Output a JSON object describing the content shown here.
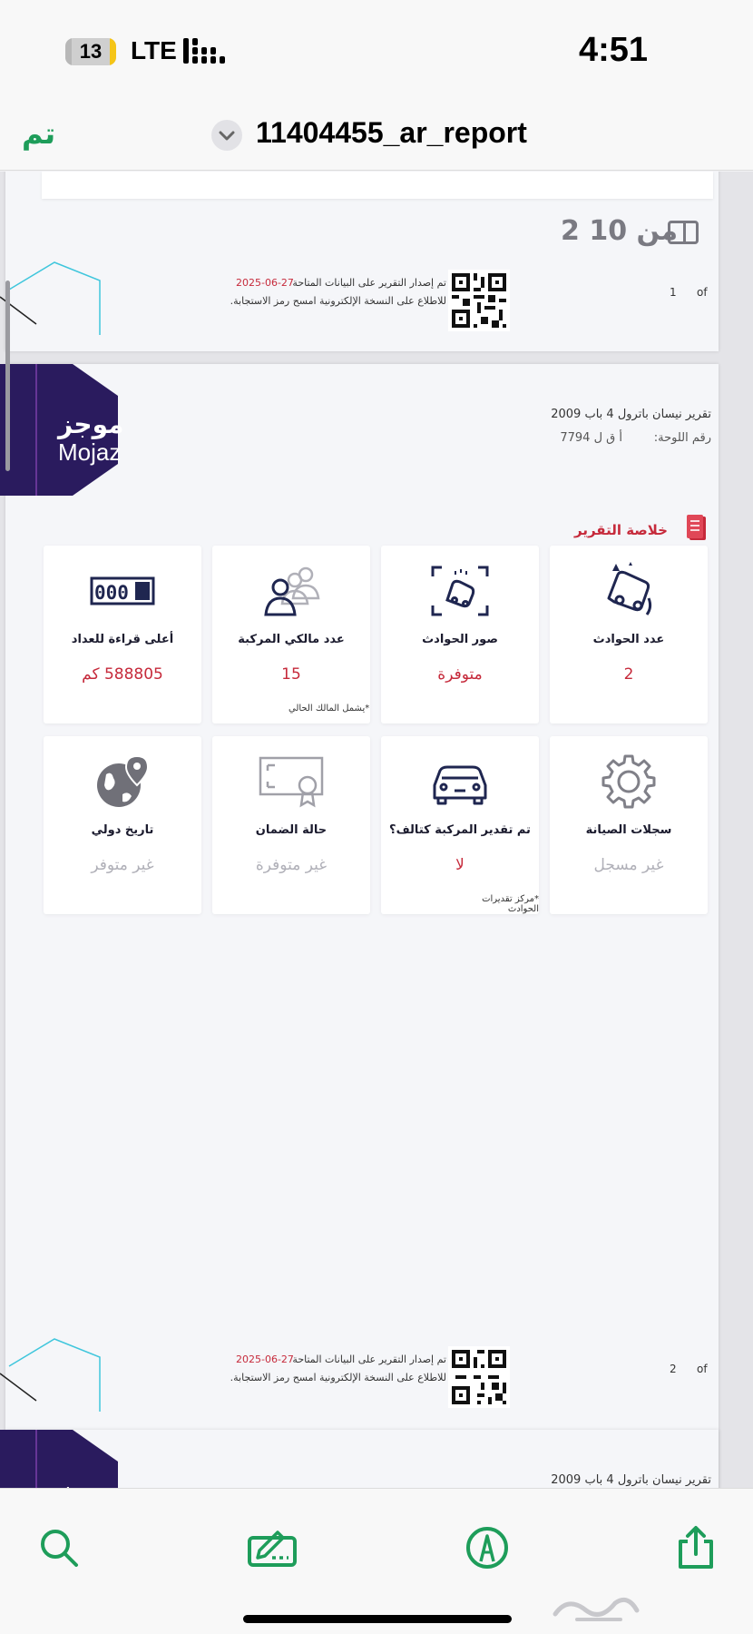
{
  "status_bar": {
    "battery": "13",
    "battery_level": 0.13,
    "network": "LTE",
    "time": "4:51"
  },
  "nav": {
    "done_label": "تم",
    "document_title": "11404455_ar_report"
  },
  "page_counter": "2 من 10",
  "footer": {
    "issued_text": "تم إصدار التقرير على البيانات المتاحة",
    "issued_date": "2025-06-27",
    "scan_text": "للاطلاع على النسخة الإلكترونية امسح رمز الاستجابة.",
    "of_label": "of",
    "page1_number": "1",
    "page2_number": "2"
  },
  "logo": {
    "arabic": "موجز",
    "english": "Mojaz"
  },
  "report": {
    "title": "تقرير نيسان باترول 4 باب 2009",
    "plate_label": "رقم اللوحة:",
    "plate_value": "أ ق ل 7794"
  },
  "summary": {
    "title": "خلاصة التقرير",
    "cards": [
      {
        "icon": "car-crash-icon",
        "label": "عدد الحوادث",
        "value": "2",
        "note": ""
      },
      {
        "icon": "accident-photos-icon",
        "label": "صور الحوادث",
        "value": "متوفرة",
        "note": ""
      },
      {
        "icon": "owners-icon",
        "label": "عدد مالكي المركبة",
        "value": "15",
        "note": "*يشمل المالك الحالي"
      },
      {
        "icon": "odometer-icon",
        "label": "أعلى قراءة للعداد",
        "value": "588805 كم",
        "note": ""
      },
      {
        "icon": "gear-icon",
        "label": "سجلات الصيانة",
        "value": "غير مسجل",
        "note": ""
      },
      {
        "icon": "damaged-car-icon",
        "label": "تم تقدير المركبة كتالف؟",
        "value": "لا",
        "note": "*مركز تقديرات الحوادث"
      },
      {
        "icon": "warranty-certificate-icon",
        "label": "حالة الضمان",
        "value": "غير متوفرة",
        "note": ""
      },
      {
        "icon": "globe-pin-icon",
        "label": "تاريخ دولي",
        "value": "غير متوفر",
        "note": ""
      }
    ],
    "odometer_digits": "000"
  },
  "colors": {
    "accent": "#1e9d5a",
    "report_red": "#c62a3b",
    "logo_navy": "#2a1b5e",
    "teal": "#3fc6dc"
  }
}
